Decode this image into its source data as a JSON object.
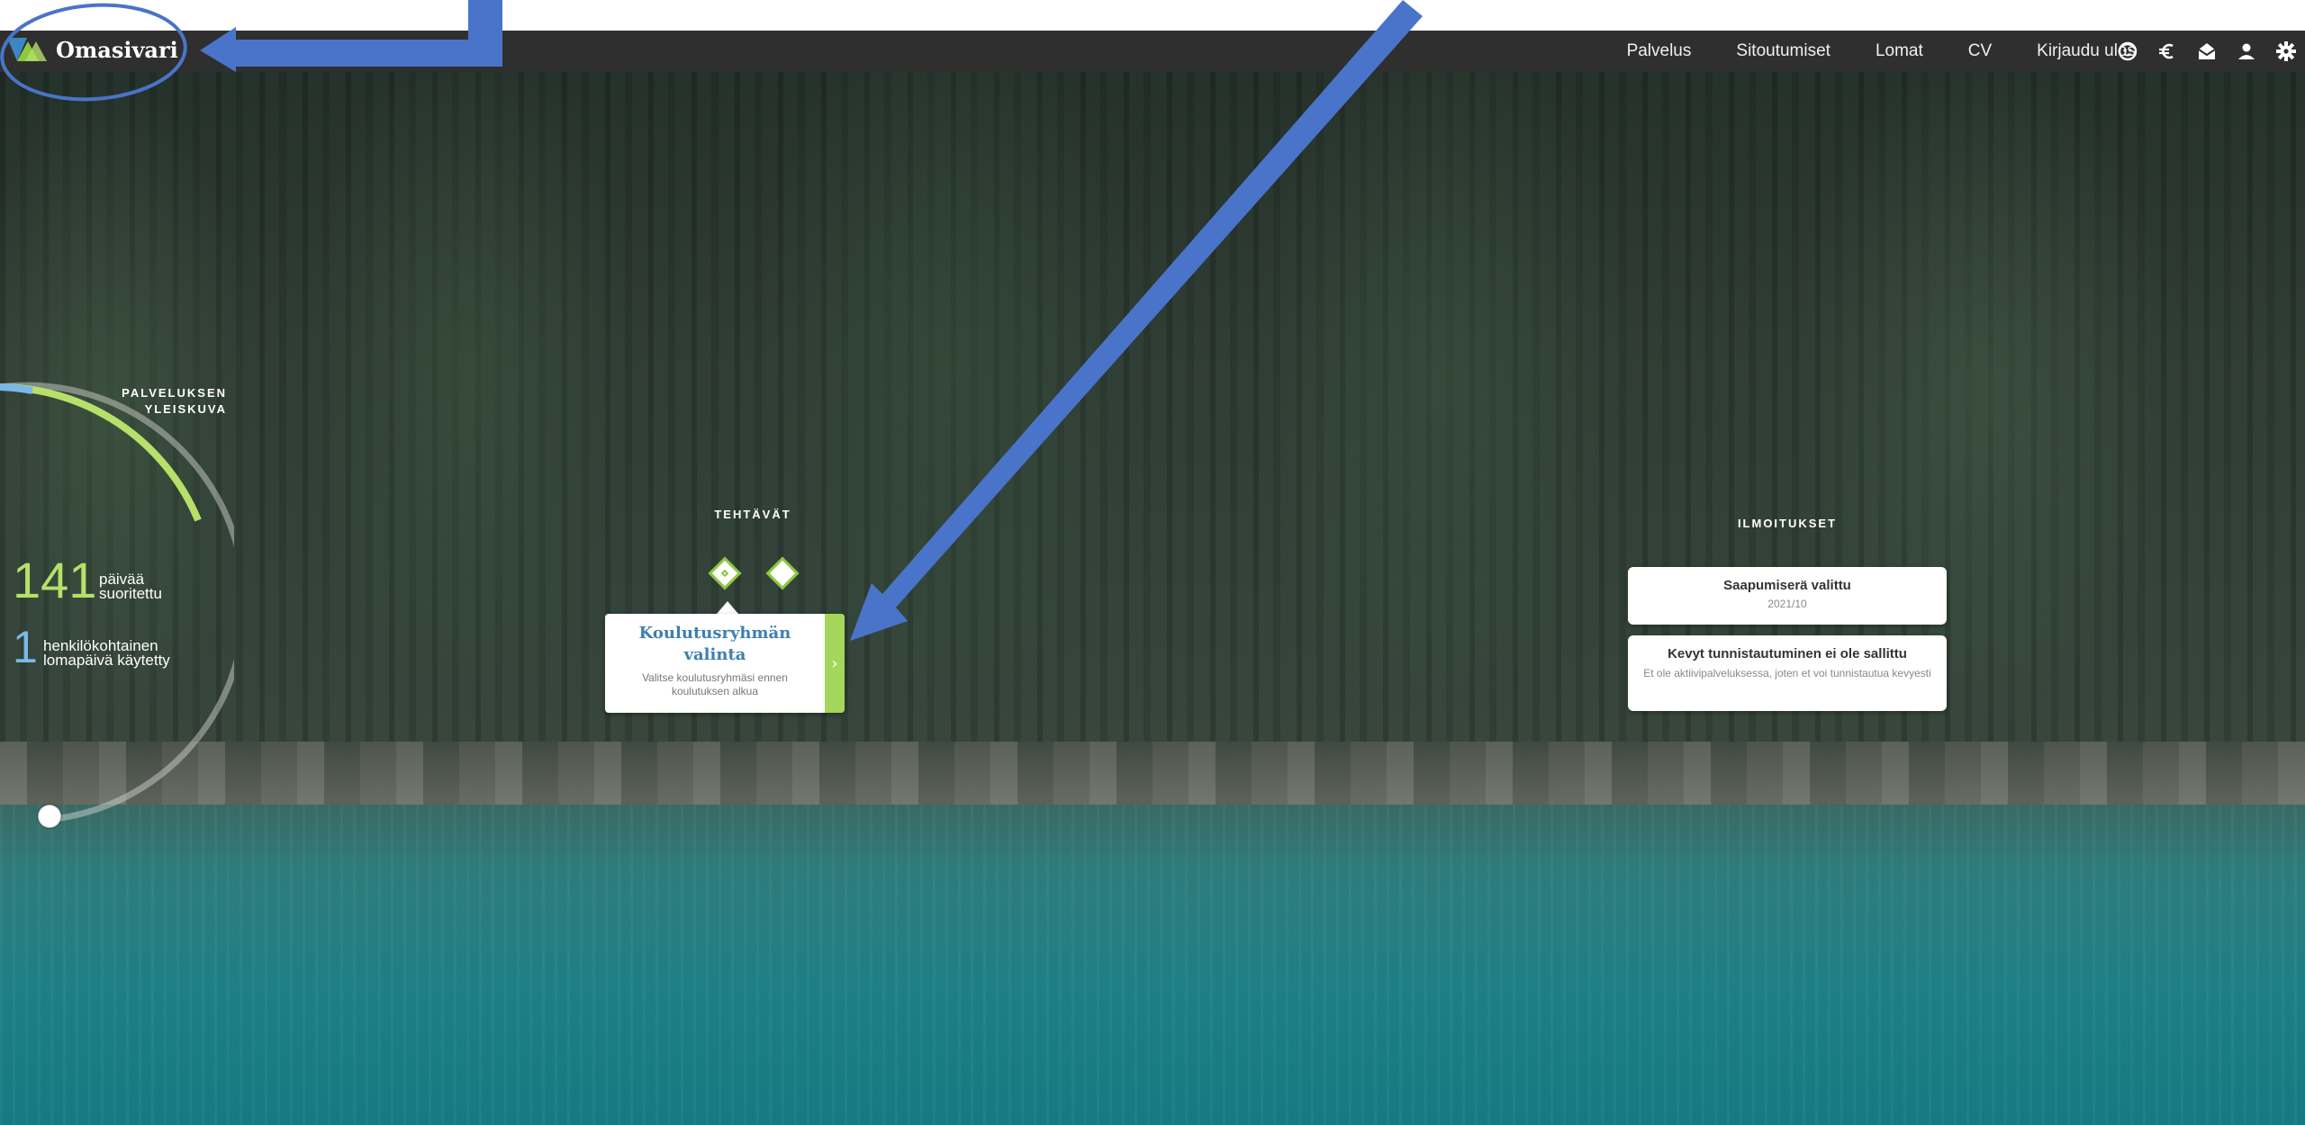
{
  "header": {
    "brand_name": "Omasivari",
    "nav": [
      "Palvelus",
      "Sitoutumiset",
      "Lomat",
      "CV",
      "Kirjaudu ulos"
    ],
    "icons": [
      "face-icon",
      "euro-icon",
      "envelope-icon",
      "user-icon",
      "gear-icon"
    ]
  },
  "overview": {
    "title": "PALVELUKSEN YLEISKUVA",
    "days_done_value": "141",
    "days_done_label": "päivää suoritettu",
    "leave_value": "1",
    "leave_label": "henkilökohtainen lomapäivä käytetty"
  },
  "tasks": {
    "title": "TEHTÄVÄT",
    "card_heading": "Koulutusryhmän valinta",
    "card_text": "Valitse koulutusryhmäsi ennen koulutuksen alkua",
    "card_arrow": "›"
  },
  "notifications": {
    "title": "ILMOITUKSET",
    "items": [
      {
        "title": "Saapumiserä valittu",
        "sub": "2021/10"
      },
      {
        "title": "Kevyt tunnistautuminen ei ole sallittu",
        "sub": "Et ole aktiivipalveluksessa, joten et voi tunnistautua kevyesti"
      }
    ]
  },
  "colors": {
    "topbar": "#2f2f2f",
    "accent_green": "#a5d65c",
    "accent_blue": "#7ab8e8",
    "annotation_blue": "#4a74c9"
  }
}
